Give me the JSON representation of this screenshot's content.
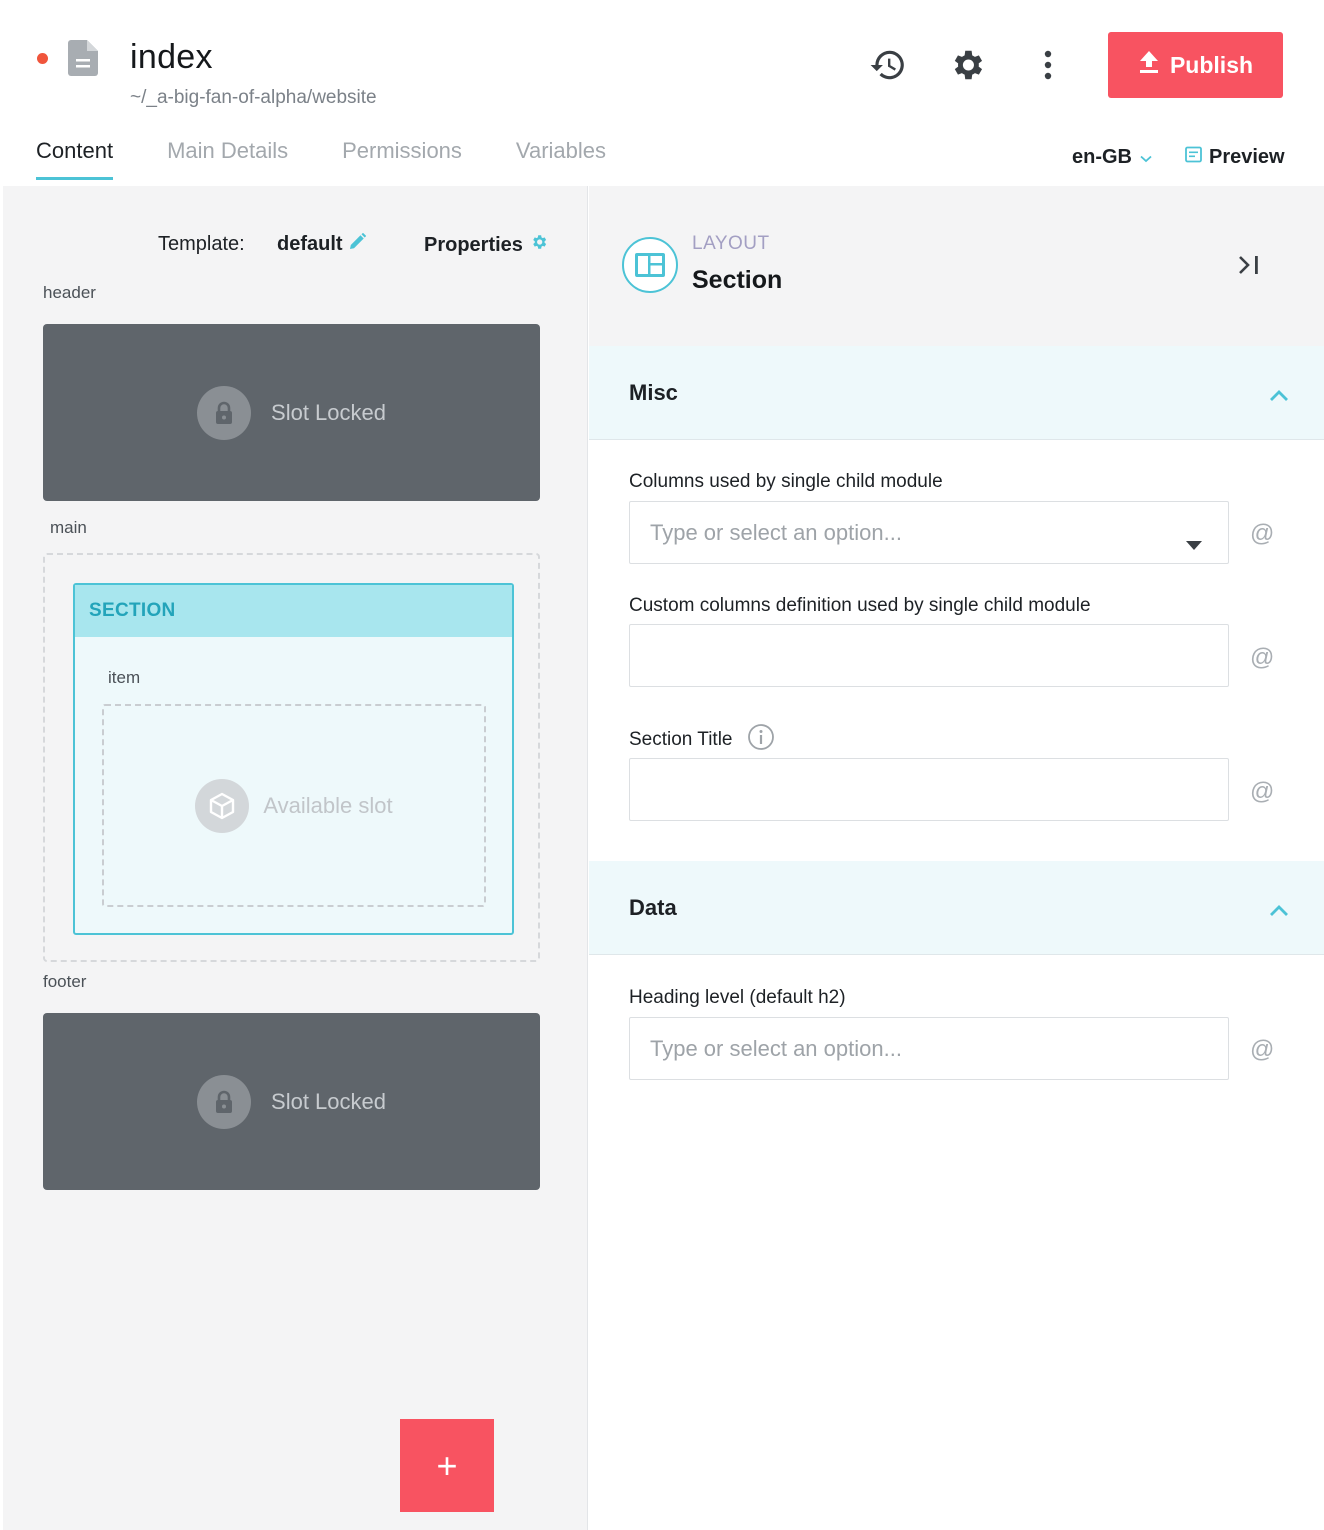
{
  "header": {
    "title": "index",
    "path": "~/_a-big-fan-of-alpha/website",
    "publish_label": "Publish",
    "status_dot_color": "#f0553c"
  },
  "tabs": [
    {
      "label": "Content",
      "active": true
    },
    {
      "label": "Main Details",
      "active": false
    },
    {
      "label": "Permissions",
      "active": false
    },
    {
      "label": "Variables",
      "active": false
    }
  ],
  "locale": {
    "value": "en-GB"
  },
  "preview_label": "Preview",
  "canvas": {
    "template_label": "Template:",
    "template_value": "default",
    "properties_label": "Properties",
    "slots": {
      "header": {
        "label": "header",
        "locked_text": "Slot Locked"
      },
      "main": {
        "label": "main",
        "section": {
          "title": "SECTION",
          "item_label": "item",
          "available_text": "Available slot"
        }
      },
      "footer": {
        "label": "footer",
        "locked_text": "Slot Locked"
      }
    },
    "add_label": "+"
  },
  "panel": {
    "kicker": "LAYOUT",
    "title": "Section",
    "groups": {
      "misc": {
        "title": "Misc",
        "fields": {
          "columns": {
            "label": "Columns used by single child module",
            "placeholder": "Type or select an option..."
          },
          "custom_columns": {
            "label": "Custom columns definition used by single child module",
            "value": ""
          },
          "section_title": {
            "label": "Section Title",
            "value": ""
          }
        }
      },
      "data": {
        "title": "Data",
        "fields": {
          "heading_level": {
            "label": "Heading level (default h2)",
            "placeholder": "Type or select an option..."
          }
        }
      }
    },
    "at_symbol": "@"
  },
  "colors": {
    "accent": "#4cc3d6",
    "primary": "#f85361",
    "locked_slot": "#5f656b"
  }
}
